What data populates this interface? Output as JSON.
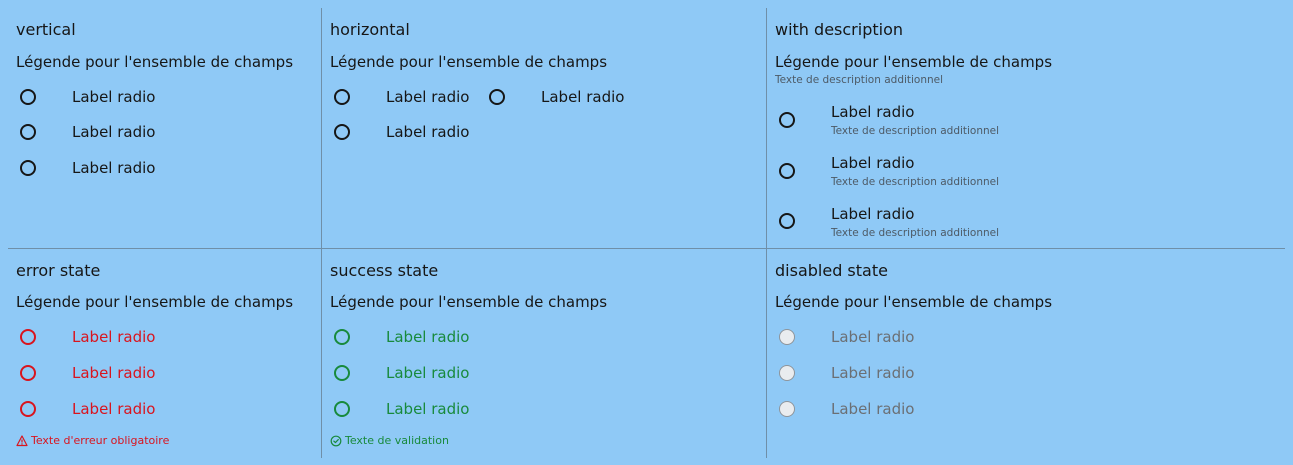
{
  "sections": {
    "vertical": {
      "title": "vertical",
      "legend": "Légende pour l'ensemble de champs",
      "radios": [
        "Label radio",
        "Label radio",
        "Label radio"
      ]
    },
    "horizontal": {
      "title": "horizontal",
      "legend": "Légende pour l'ensemble de champs",
      "radios": [
        "Label radio",
        "Label radio",
        "Label radio"
      ]
    },
    "with_description": {
      "title": "with description",
      "legend": "Légende pour l'ensemble de champs",
      "hint": "Texte de description additionnel",
      "radios": [
        {
          "label": "Label radio",
          "hint": "Texte de description additionnel"
        },
        {
          "label": "Label radio",
          "hint": "Texte de description additionnel"
        },
        {
          "label": "Label radio",
          "hint": "Texte de description additionnel"
        }
      ]
    },
    "error": {
      "title": "error state",
      "legend": "Légende pour l'ensemble de champs",
      "radios": [
        "Label radio",
        "Label radio",
        "Label radio"
      ],
      "message": "Texte d'erreur obligatoire",
      "message_icon": "warning-icon",
      "color": "#d9141e"
    },
    "success": {
      "title": "success state",
      "legend": "Légende pour l'ensemble de champs",
      "radios": [
        "Label radio",
        "Label radio",
        "Label radio"
      ],
      "message": "Texte de validation",
      "message_icon": "check-circle-icon",
      "color": "#188a3c"
    },
    "disabled": {
      "title": "disabled state",
      "legend": "Légende pour l'ensemble de champs",
      "radios": [
        "Label radio",
        "Label radio",
        "Label radio"
      ]
    }
  }
}
